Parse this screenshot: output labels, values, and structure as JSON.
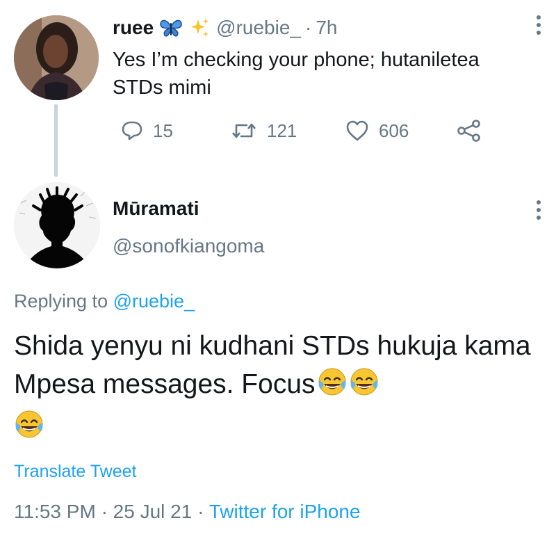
{
  "parent_tweet": {
    "display_name": "ruee",
    "name_emojis": [
      "butterfly-icon",
      "sparkles-icon"
    ],
    "handle": "@ruebie_",
    "separator": "·",
    "time": "7h",
    "text": "Yes I’m checking your phone; hutaniletea STDs mimi",
    "actions": {
      "reply_count": "15",
      "retweet_count": "121",
      "like_count": "606"
    }
  },
  "tweet": {
    "display_name": "Mūramati",
    "handle": "@sonofkiangoma",
    "replying_prefix": "Replying to",
    "replying_to": "@ruebie_",
    "text": "Shida yenyu ni kudhani STDs hukuja kama Mpesa messages. Focus",
    "trailing_emojis": [
      "face-with-tears-of-joy-icon",
      "face-with-tears-of-joy-icon",
      "face-with-tears-of-joy-icon"
    ],
    "translate_label": "Translate Tweet",
    "time": "11:53 PM",
    "sep1": "·",
    "date": "25 Jul 21",
    "sep2": "·",
    "source": "Twitter for iPhone"
  },
  "colors": {
    "text": "#14171a",
    "secondary": "#657786",
    "accent": "#1da1f2",
    "thread_line": "#c9d3dc"
  }
}
